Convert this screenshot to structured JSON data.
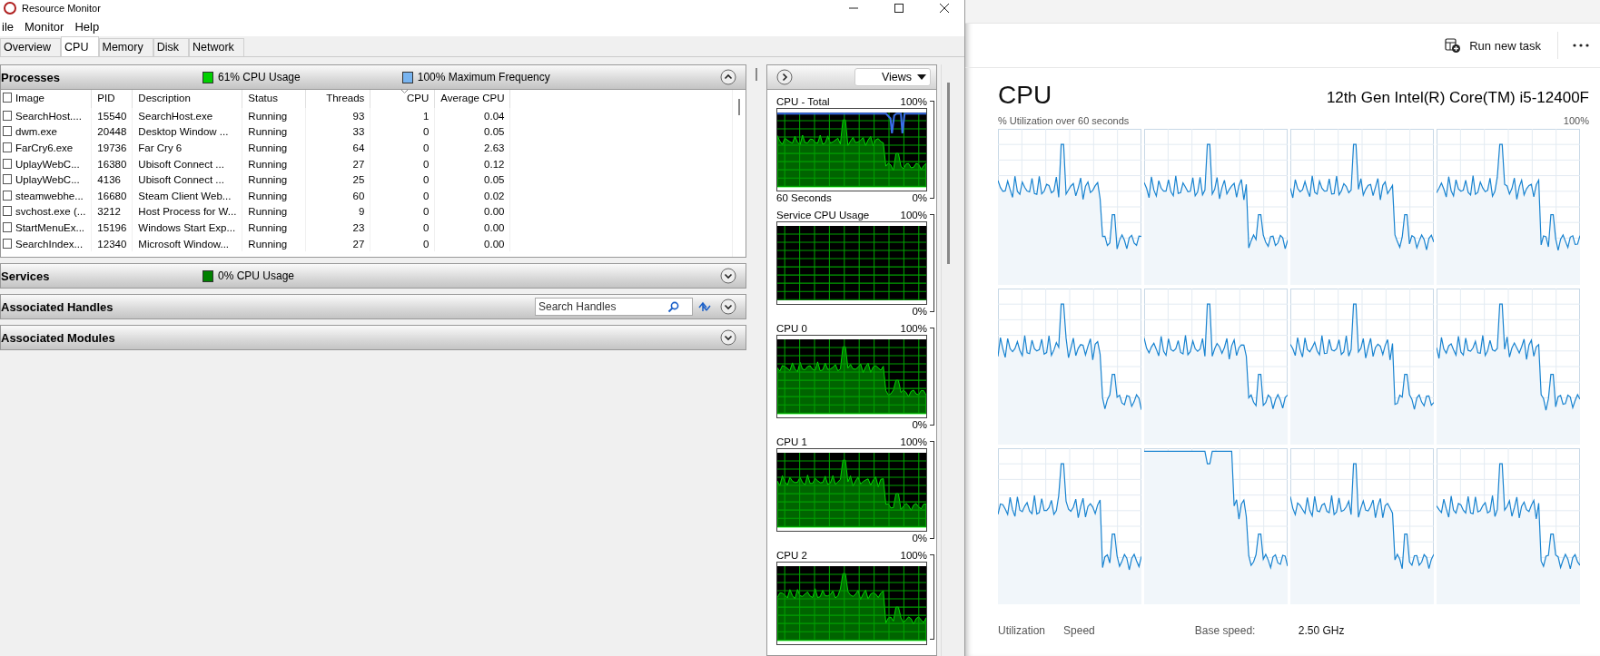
{
  "window": {
    "title": "Resource Monitor"
  },
  "menu": [
    "ile",
    "Monitor",
    "Help"
  ],
  "tabs": [
    {
      "label": "Overview",
      "selected": false
    },
    {
      "label": "CPU",
      "selected": true
    },
    {
      "label": "Memory",
      "selected": false
    },
    {
      "label": "Disk",
      "selected": false
    },
    {
      "label": "Network",
      "selected": false
    }
  ],
  "processes": {
    "title": "Processes",
    "expanded": true,
    "legend": [
      {
        "text": "61% CPU Usage",
        "color": "#00d000"
      },
      {
        "text": "100% Maximum Frequency",
        "color": "#78b4f0"
      }
    ],
    "header_checked": false,
    "columns": [
      {
        "label": "Image",
        "sorted": false
      },
      {
        "label": "PID",
        "sorted": false
      },
      {
        "label": "Description",
        "sorted": false
      },
      {
        "label": "Status",
        "sorted": false
      },
      {
        "label": "Threads",
        "sorted": false
      },
      {
        "label": "CPU",
        "sorted": true
      },
      {
        "label": "Average CPU",
        "sorted": false
      }
    ],
    "rows": [
      {
        "checked": false,
        "cells": [
          "SearchHost....",
          "15540",
          "SearchHost.exe",
          "Running",
          "93",
          "1",
          "0.04"
        ]
      },
      {
        "checked": false,
        "cells": [
          "dwm.exe",
          "20448",
          "Desktop Window ...",
          "Running",
          "33",
          "0",
          "0.05"
        ]
      },
      {
        "checked": false,
        "cells": [
          "FarCry6.exe",
          "19736",
          "Far Cry 6",
          "Running",
          "64",
          "0",
          "2.63"
        ]
      },
      {
        "checked": false,
        "cells": [
          "UplayWebC...",
          "16380",
          "Ubisoft Connect ...",
          "Running",
          "27",
          "0",
          "0.12"
        ]
      },
      {
        "checked": false,
        "cells": [
          "UplayWebC...",
          "4136",
          "Ubisoft Connect ...",
          "Running",
          "25",
          "0",
          "0.05"
        ]
      },
      {
        "checked": false,
        "cells": [
          "steamwebhe...",
          "16680",
          "Steam Client Web...",
          "Running",
          "60",
          "0",
          "0.02"
        ]
      },
      {
        "checked": false,
        "cells": [
          "svchost.exe (...",
          "3212",
          "Host Process for W...",
          "Running",
          "9",
          "0",
          "0.00"
        ]
      },
      {
        "checked": false,
        "cells": [
          "StartMenuEx...",
          "15196",
          "Windows Start Exp...",
          "Running",
          "23",
          "0",
          "0.00"
        ]
      },
      {
        "checked": false,
        "cells": [
          "SearchIndex...",
          "12340",
          "Microsoft Window...",
          "Running",
          "27",
          "0",
          "0.00"
        ]
      }
    ]
  },
  "sections": [
    {
      "title": "Services",
      "expanded": false,
      "legend": [
        {
          "text": "0% CPU Usage",
          "color": "#008000"
        }
      ]
    },
    {
      "title": "Associated Handles",
      "expanded": false,
      "search": {
        "placeholder": "Search Handles"
      }
    },
    {
      "title": "Associated Modules",
      "expanded": false
    }
  ],
  "graph_panel": {
    "views_button": "Views",
    "graphs": [
      {
        "title": "CPU - Total",
        "max": "100%",
        "min": "0%",
        "time_label": "60 Seconds",
        "frequency_line": true,
        "kind": "load"
      },
      {
        "title": "Service CPU Usage",
        "max": "100%",
        "min": "0%",
        "frequency_line": false,
        "kind": "idle"
      },
      {
        "title": "CPU 0",
        "max": "100%",
        "min": "0%",
        "frequency_line": false,
        "kind": "load"
      },
      {
        "title": "CPU 1",
        "max": "100%",
        "min": "0%",
        "frequency_line": false,
        "kind": "load"
      },
      {
        "title": "CPU 2",
        "max": "100%",
        "frequency_line": false,
        "kind": "load"
      }
    ]
  },
  "task_manager": {
    "run_new_task": "Run new task",
    "heading": "CPU",
    "model": "12th Gen Intel(R) Core(TM) i5-12400F",
    "graph_caption": "% Utilization over 60 seconds",
    "graph_max": "100%",
    "stat_labels": [
      "Utilization",
      "Speed"
    ],
    "details": [
      {
        "label": "Base speed:",
        "value": "2.50 GHz"
      }
    ]
  }
}
